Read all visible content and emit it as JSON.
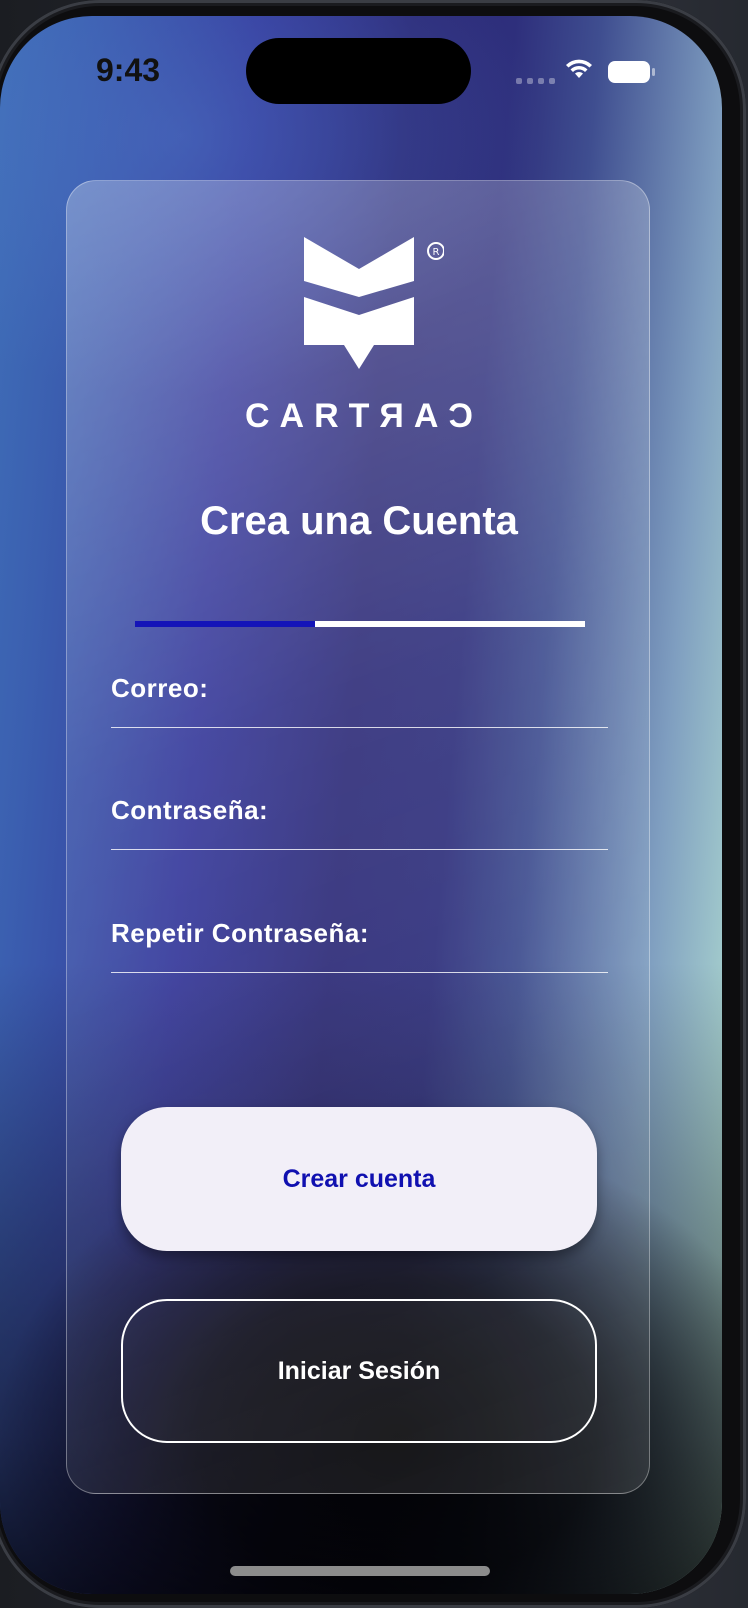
{
  "status_bar": {
    "time": "9:43"
  },
  "brand": {
    "name": "CARTRAC",
    "wordmark": "CARTЯAƆ",
    "registered_mark": "®"
  },
  "page": {
    "title": "Crea una Cuenta",
    "progress_step_fraction": 0.4
  },
  "form": {
    "fields": [
      {
        "label": "Correo:",
        "value": ""
      },
      {
        "label": "Contraseña:",
        "value": ""
      },
      {
        "label": "Repetir Contraseña:",
        "value": ""
      }
    ]
  },
  "actions": {
    "primary_label": "Crear cuenta",
    "secondary_label": "Iniciar Sesión"
  },
  "colors": {
    "accent": "#1414b8",
    "primary_button_bg": "#f2eff8",
    "primary_button_text": "#1010b0",
    "text_light": "#ffffff"
  },
  "icons": {
    "wifi": "wifi-icon",
    "battery": "battery-icon",
    "signal": "cellular-signal-icon",
    "logo": "book-logo-icon"
  }
}
